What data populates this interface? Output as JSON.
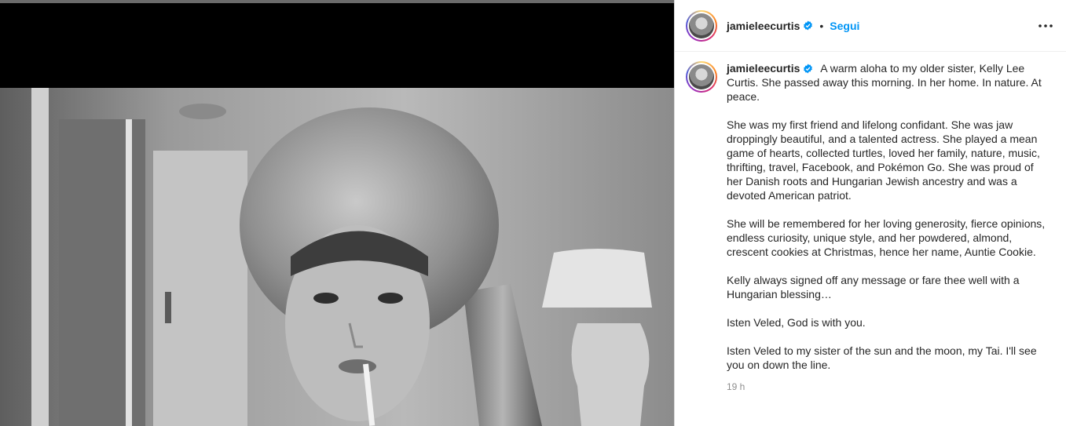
{
  "header": {
    "username": "jamieleecurtis",
    "separator": "•",
    "follow_label": "Segui",
    "more_icon": "more-horizontal-icon"
  },
  "caption": {
    "username": "jamieleecurtis",
    "first_line": "A warm aloha to my older sister, Kelly Lee Curtis. She passed away this morning. In her home. In nature. At peace.",
    "paragraphs": [
      "She was my first friend and lifelong confidant. She was jaw droppingly beautiful, and a talented actress. She played a mean game of hearts, collected turtles, loved her family, nature, music, thrifting, travel, Facebook, and Pokémon Go. She was proud of her Danish roots and Hungarian Jewish ancestry and was a devoted American patriot.",
      "She will be remembered for her loving generosity, fierce opinions, endless curiosity, unique style, and her powdered, almond, crescent cookies at Christmas, hence her name, Auntie Cookie.",
      "Kelly always signed off any message or fare thee well with a Hungarian blessing…",
      "Isten Veled, God is with you.",
      "Isten Veled to my sister of the sun and the moon, my Tai. I'll see you on down the line."
    ],
    "timestamp": "19 h"
  },
  "colors": {
    "accent": "#0095f6",
    "verified": "#0095f6",
    "text": "#262626",
    "muted": "#8e8e8e"
  }
}
